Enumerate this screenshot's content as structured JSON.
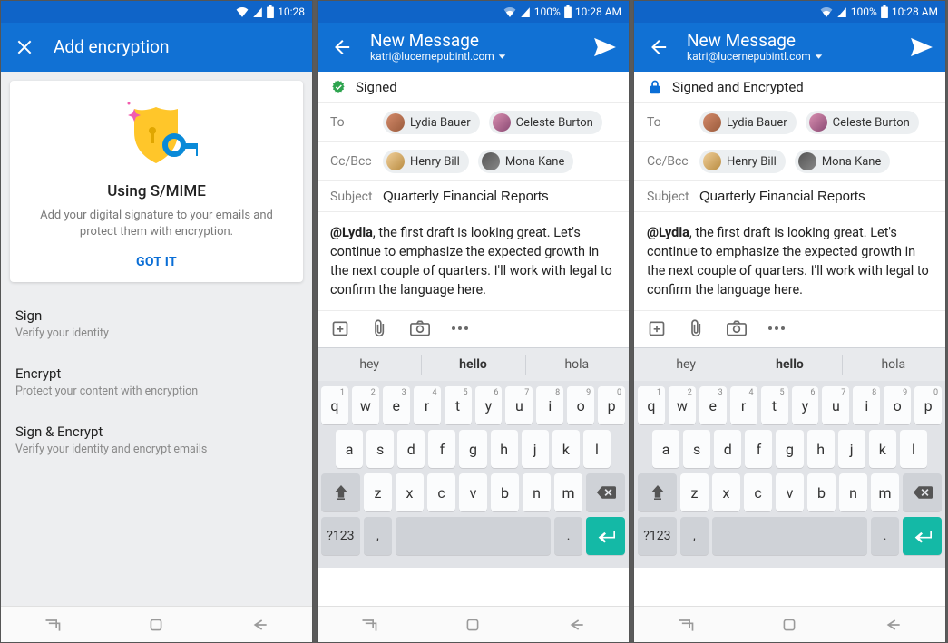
{
  "screen1": {
    "status": {
      "time": "10:28"
    },
    "appbar": {
      "title": "Add encryption"
    },
    "card": {
      "title": "Using S/MIME",
      "desc": "Add your digital signature to your emails and protect them with encryption.",
      "button": "GOT IT"
    },
    "options": [
      {
        "title": "Sign",
        "desc": "Verify your identity"
      },
      {
        "title": "Encrypt",
        "desc": "Protect your content with encryption"
      },
      {
        "title": "Sign & Encrypt",
        "desc": "Verify your identity and encrypt emails"
      }
    ]
  },
  "screen2": {
    "status": {
      "battery": "100%",
      "time": "10:28 AM"
    },
    "appbar": {
      "title": "New Message",
      "subtitle": "katri@lucernepubintl.com"
    },
    "security_status": {
      "icon": "rosette-signed",
      "text": "Signed"
    },
    "to_label": "To",
    "to": [
      {
        "name": "Lydia Bauer"
      },
      {
        "name": "Celeste Burton"
      }
    ],
    "cc_label": "Cc/Bcc",
    "cc": [
      {
        "name": "Henry Bill"
      },
      {
        "name": "Mona Kane"
      }
    ],
    "subject_label": "Subject",
    "subject": "Quarterly Financial Reports",
    "body_mention": "@Lydia",
    "body_rest": ", the first draft is looking great. Let's continue to emphasize the expected growth in the next couple of quarters. I'll work with legal to confirm the language here."
  },
  "screen3": {
    "status": {
      "battery": "100%",
      "time": "10:28 AM"
    },
    "appbar": {
      "title": "New Message",
      "subtitle": "katri@lucernepubintl.com"
    },
    "security_status": {
      "icon": "lock-signed-encrypted",
      "text": "Signed and Encrypted"
    },
    "to_label": "To",
    "to": [
      {
        "name": "Lydia Bauer"
      },
      {
        "name": "Celeste Burton"
      }
    ],
    "cc_label": "Cc/Bcc",
    "cc": [
      {
        "name": "Henry Bill"
      },
      {
        "name": "Mona Kane"
      }
    ],
    "subject_label": "Subject",
    "subject": "Quarterly Financial Reports",
    "body_mention": "@Lydia",
    "body_rest": ", the first draft is looking great. Let's continue to emphasize the expected growth in the next couple of quarters. I'll work with legal to confirm the language here."
  },
  "keyboard": {
    "suggestions": [
      "hey",
      "hello",
      "hola"
    ],
    "row1": [
      {
        "k": "q",
        "s": "1"
      },
      {
        "k": "w",
        "s": "2"
      },
      {
        "k": "e",
        "s": "3"
      },
      {
        "k": "r",
        "s": "4"
      },
      {
        "k": "t",
        "s": "5"
      },
      {
        "k": "y",
        "s": "6"
      },
      {
        "k": "u",
        "s": "7"
      },
      {
        "k": "i",
        "s": "8"
      },
      {
        "k": "o",
        "s": "9"
      },
      {
        "k": "p",
        "s": "0"
      }
    ],
    "row2": [
      "a",
      "s",
      "d",
      "f",
      "g",
      "h",
      "j",
      "k",
      "l"
    ],
    "row3": [
      "z",
      "x",
      "c",
      "v",
      "b",
      "n",
      "m"
    ],
    "sym_key": "?123",
    "comma": ",",
    "period": "."
  }
}
